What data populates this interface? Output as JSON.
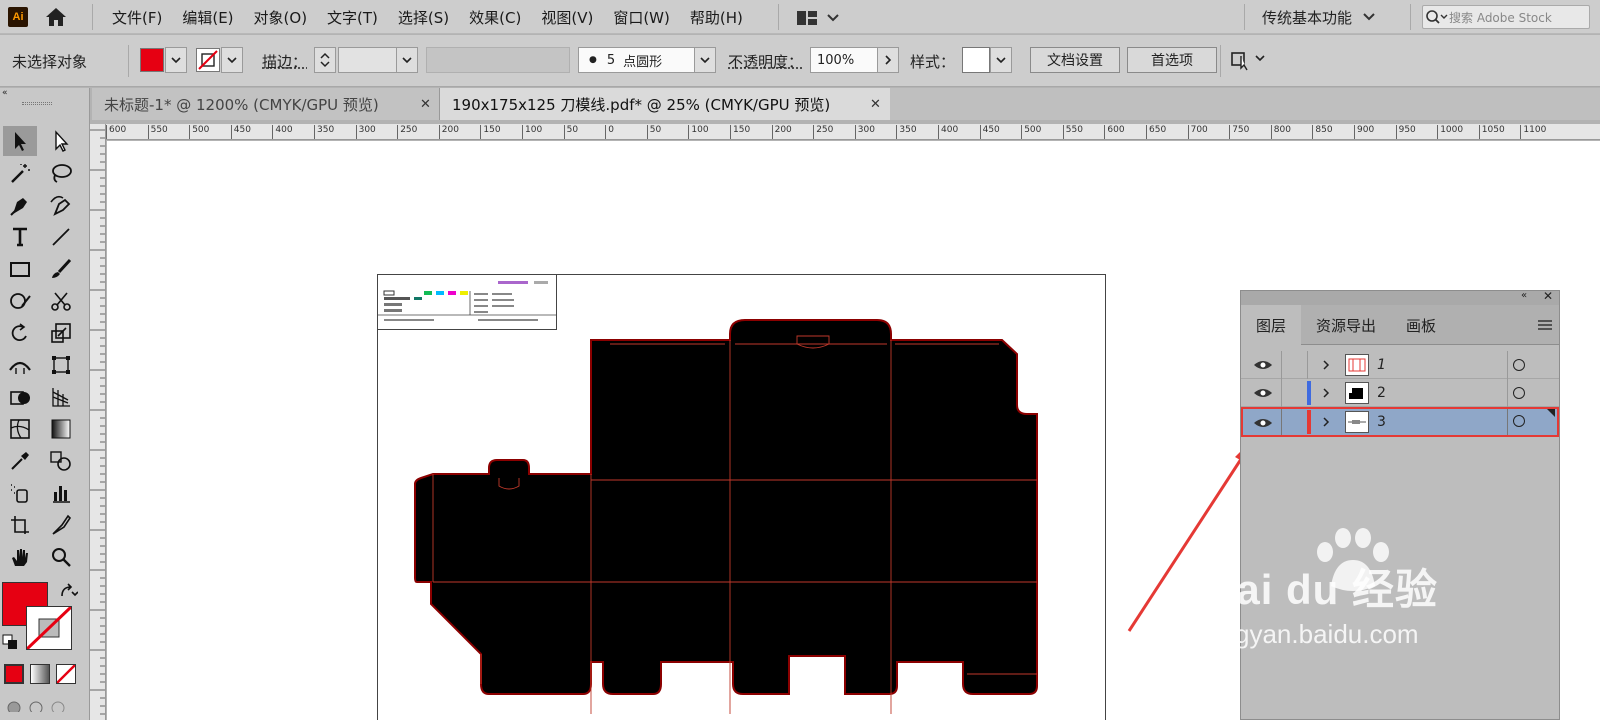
{
  "app": {
    "logo": "Ai"
  },
  "menu": [
    "文件(F)",
    "编辑(E)",
    "对象(O)",
    "文字(T)",
    "选择(S)",
    "效果(C)",
    "视图(V)",
    "窗口(W)",
    "帮助(H)"
  ],
  "workspace": {
    "label": "传统基本功能"
  },
  "stock_search": {
    "placeholder": "搜索 Adobe Stock"
  },
  "control": {
    "selection_status": "未选择对象",
    "fill_color": "#e60012",
    "stroke_label": "描边：",
    "brush_size": "5",
    "brush_name": "点圆形",
    "opacity_label": "不透明度：",
    "opacity_value": "100%",
    "style_label": "样式：",
    "doc_setup": "文档设置",
    "preferences": "首选项"
  },
  "tabs": [
    {
      "label": "未标题-1* @ 1200% (CMYK/GPU 预览)",
      "active": false
    },
    {
      "label": "190x175x125 刀模线.pdf* @ 25% (CMYK/GPU 预览)",
      "active": true
    }
  ],
  "ruler_ticks": [
    "600",
    "550",
    "500",
    "450",
    "400",
    "350",
    "300",
    "250",
    "200",
    "150",
    "100",
    "50",
    "0",
    "50",
    "100",
    "150",
    "200",
    "250",
    "300",
    "350",
    "400",
    "450",
    "500",
    "550",
    "600",
    "650",
    "700",
    "750",
    "800",
    "850",
    "900",
    "950",
    "1000",
    "1050",
    "1100"
  ],
  "layers_panel": {
    "tabs": [
      "图层",
      "资源导出",
      "画板"
    ],
    "layers": [
      {
        "name": "1",
        "selected": false
      },
      {
        "name": "2",
        "selected": false
      },
      {
        "name": "3",
        "selected": true
      }
    ]
  },
  "watermark": {
    "brand": "Bai du 经验",
    "url": "jingyan.baidu.com"
  },
  "colors": {
    "fill": "#e60012",
    "die_line": "#c0392b",
    "selection_highlight": "#e53935",
    "layer_selected": "#8fa7c8"
  }
}
